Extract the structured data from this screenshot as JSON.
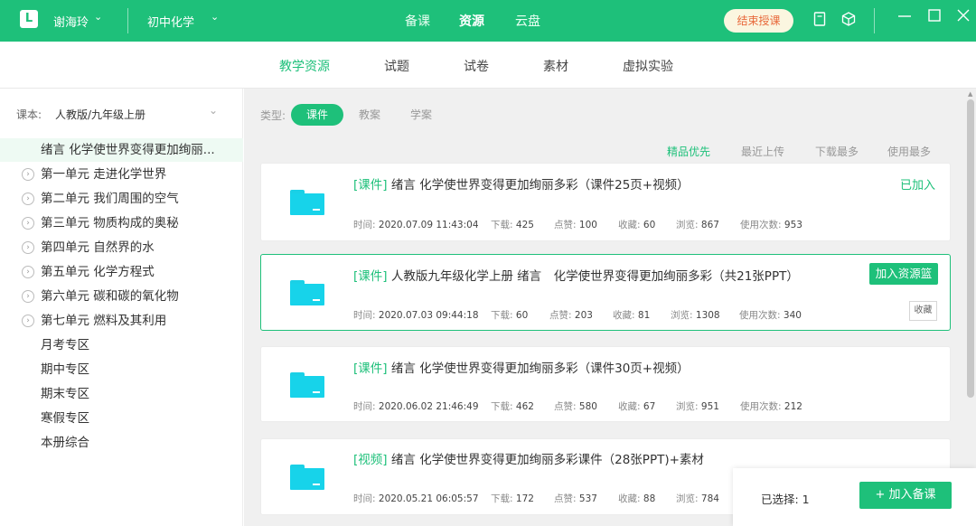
{
  "topbar": {
    "logo": "L",
    "user": "谢海玲",
    "subject": "初中化学",
    "nav": [
      "备课",
      "资源",
      "云盘"
    ],
    "active_nav": "资源",
    "end_button": "结束授课",
    "accent": "#1ec07a"
  },
  "subnav": {
    "items": [
      "教学资源",
      "试题",
      "试卷",
      "素材",
      "虚拟实验"
    ],
    "active": "教学资源"
  },
  "sidebar": {
    "course_label": "课本:",
    "course_value": "人教版/九年级上册",
    "items": [
      "绪言 化学使世界变得更加绚丽...",
      "第一单元 走进化学世界",
      "第二单元 我们周围的空气",
      "第三单元 物质构成的奥秘",
      "第四单元 自然界的水",
      "第五单元 化学方程式",
      "第六单元 碳和碳的氧化物",
      "第七单元 燃料及其利用",
      "月考专区",
      "期中专区",
      "期末专区",
      "寒假专区",
      "本册综合"
    ]
  },
  "filter": {
    "type_label": "类型:",
    "types": [
      "课件",
      "教案",
      "学案"
    ],
    "active_type": "课件",
    "sorts": [
      "精品优先",
      "最近上传",
      "下载最多",
      "使用最多"
    ],
    "active_sort": "精品优先"
  },
  "meta_labels": {
    "time": "时间:",
    "download": "下载:",
    "like": "点赞:",
    "collect": "收藏:",
    "view": "浏览:",
    "use": "使用次数:"
  },
  "resources": [
    {
      "tag": "[课件]",
      "title": " 绪言 化学使世界变得更加绚丽多彩（课件25页+视频）",
      "time": "2020.07.09 11:43:04",
      "download": "425",
      "like": "100",
      "collect": "60",
      "view": "867",
      "use": "953",
      "status": "已加入"
    },
    {
      "tag": "[课件]",
      "title": " 人教版九年级化学上册 绪言　化学使世界变得更加绚丽多彩（共21张PPT）",
      "time": "2020.07.03 09:44:18",
      "download": "60",
      "like": "203",
      "collect": "81",
      "view": "1308",
      "use": "340",
      "action": "加入资源篮",
      "fav": "收藏"
    },
    {
      "tag": "[课件]",
      "title": " 绪言 化学使世界变得更加绚丽多彩（课件30页+视频）",
      "time": "2020.06.02 21:46:49",
      "download": "462",
      "like": "580",
      "collect": "67",
      "view": "951",
      "use": "212"
    },
    {
      "tag": "[视频]",
      "title": " 绪言 化学使世界变得更加绚丽多彩课件（28张PPT)+素材",
      "time": "2020.05.21 06:05:57",
      "download": "172",
      "like": "537",
      "collect": "88",
      "view": "784"
    }
  ],
  "footer": {
    "selected": "已选择: 1",
    "add_lesson": "+ 加入备课"
  }
}
